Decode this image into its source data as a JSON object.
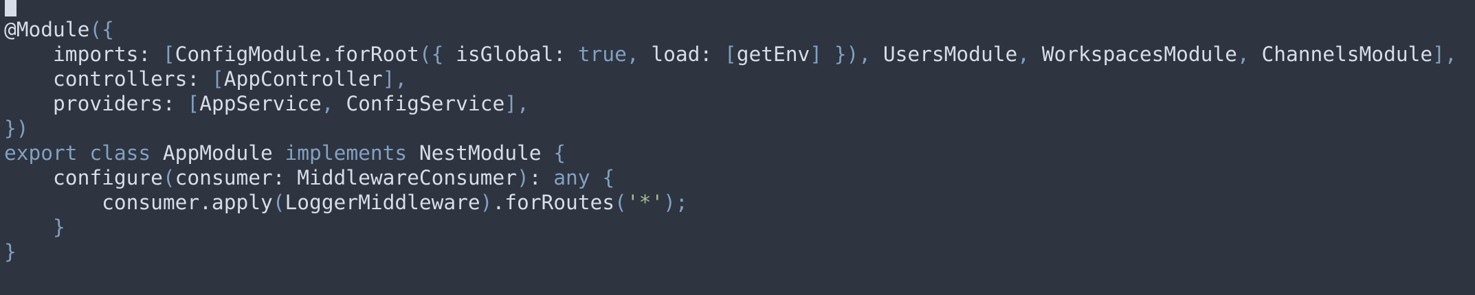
{
  "editor": {
    "colors": {
      "background": "#2e3440",
      "text": "#d8dee9",
      "keyword": "#81a1c1",
      "punctuation": "#81a1c1",
      "string": "#a3be8c",
      "cursor": "#d8dee9"
    },
    "lines": [
      [
        {
          "t": "@Module",
          "c": "pl"
        },
        {
          "t": "({",
          "c": "pn"
        }
      ],
      [
        {
          "t": "    imports: ",
          "c": "pl"
        },
        {
          "t": "[",
          "c": "pn"
        },
        {
          "t": "ConfigModule.forRoot",
          "c": "pl"
        },
        {
          "t": "({",
          "c": "pn"
        },
        {
          "t": " isGlobal: ",
          "c": "pl"
        },
        {
          "t": "true",
          "c": "kw"
        },
        {
          "t": ",",
          "c": "pn"
        },
        {
          "t": " load: ",
          "c": "pl"
        },
        {
          "t": "[",
          "c": "pn"
        },
        {
          "t": "getEnv",
          "c": "pl"
        },
        {
          "t": "]",
          "c": "pn"
        },
        {
          "t": " ",
          "c": "pl"
        },
        {
          "t": "}),",
          "c": "pn"
        },
        {
          "t": " UsersModule",
          "c": "pl"
        },
        {
          "t": ",",
          "c": "pn"
        },
        {
          "t": " WorkspacesModule",
          "c": "pl"
        },
        {
          "t": ",",
          "c": "pn"
        },
        {
          "t": " ChannelsModule",
          "c": "pl"
        },
        {
          "t": "],",
          "c": "pn"
        }
      ],
      [
        {
          "t": "    controllers: ",
          "c": "pl"
        },
        {
          "t": "[",
          "c": "pn"
        },
        {
          "t": "AppController",
          "c": "pl"
        },
        {
          "t": "],",
          "c": "pn"
        }
      ],
      [
        {
          "t": "    providers: ",
          "c": "pl"
        },
        {
          "t": "[",
          "c": "pn"
        },
        {
          "t": "AppService",
          "c": "pl"
        },
        {
          "t": ",",
          "c": "pn"
        },
        {
          "t": " ConfigService",
          "c": "pl"
        },
        {
          "t": "],",
          "c": "pn"
        }
      ],
      [
        {
          "t": "})",
          "c": "pn"
        }
      ],
      [
        {
          "t": "export",
          "c": "kw"
        },
        {
          "t": " ",
          "c": "pl"
        },
        {
          "t": "class",
          "c": "kw"
        },
        {
          "t": " AppModule ",
          "c": "pl"
        },
        {
          "t": "implements",
          "c": "kw"
        },
        {
          "t": " NestModule ",
          "c": "pl"
        },
        {
          "t": "{",
          "c": "pn"
        }
      ],
      [
        {
          "t": "    configure",
          "c": "pl"
        },
        {
          "t": "(",
          "c": "pn"
        },
        {
          "t": "consumer: MiddlewareConsumer",
          "c": "pl"
        },
        {
          "t": ")",
          "c": "pn"
        },
        {
          "t": ": ",
          "c": "pl"
        },
        {
          "t": "any",
          "c": "kw"
        },
        {
          "t": " ",
          "c": "pl"
        },
        {
          "t": "{",
          "c": "pn"
        }
      ],
      [
        {
          "t": "        consumer.apply",
          "c": "pl"
        },
        {
          "t": "(",
          "c": "pn"
        },
        {
          "t": "LoggerMiddleware",
          "c": "pl"
        },
        {
          "t": ")",
          "c": "pn"
        },
        {
          "t": ".forRoutes",
          "c": "pl"
        },
        {
          "t": "(",
          "c": "pn"
        },
        {
          "t": "'*'",
          "c": "st"
        },
        {
          "t": ");",
          "c": "pn"
        }
      ],
      [
        {
          "t": "    }",
          "c": "pn"
        }
      ],
      [
        {
          "t": "}",
          "c": "pn"
        }
      ]
    ]
  }
}
